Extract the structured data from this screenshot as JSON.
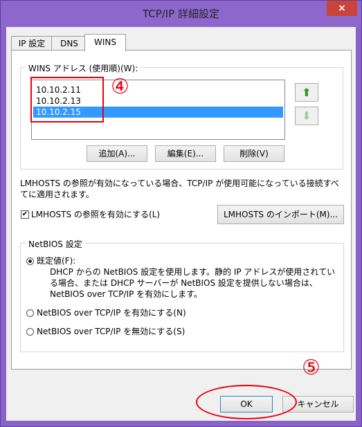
{
  "window": {
    "title": "TCP/IP 詳細設定",
    "close_label": "×"
  },
  "tabs": [
    {
      "label": "IP 設定"
    },
    {
      "label": "DNS"
    },
    {
      "label": "WINS"
    }
  ],
  "wins": {
    "group_label": "WINS アドレス (使用順)(W):",
    "addresses": [
      "10.10.2.11",
      "10.10.2.13",
      "10.10.2.15"
    ],
    "selected_index": 2,
    "up_arrow": "⬆",
    "down_arrow": "⬇",
    "add_button": "追加(A)...",
    "edit_button": "編集(E)...",
    "delete_button": "削除(V)"
  },
  "lmhosts": {
    "description": "LMHOSTS の参照が有効になっている場合、TCP/IP が使用可能になっている接続すべてに適用されます。",
    "checkbox_label": "LMHOSTS の参照を有効にする(L)",
    "checked": true,
    "check_mark": "✔",
    "import_button": "LMHOSTS のインポート(M)..."
  },
  "netbios": {
    "group_label": "NetBIOS 設定",
    "options": [
      {
        "label": "既定値(F):",
        "checked": true,
        "description": "DHCP からの NetBIOS 設定を使用します。静的 IP アドレスが使用されている場合、または DHCP サーバーが NetBIOS 設定を提供しない場合は、NetBIOS over TCP/IP を有効にします。"
      },
      {
        "label": "NetBIOS over TCP/IP を有効にする(N)",
        "checked": false
      },
      {
        "label": "NetBIOS over TCP/IP を無効にする(S)",
        "checked": false
      }
    ]
  },
  "footer": {
    "ok_button": "OK",
    "cancel_button": "キャンセル"
  },
  "annotations": {
    "step4": "④",
    "step5": "⑤",
    "color": "#e8000b"
  }
}
